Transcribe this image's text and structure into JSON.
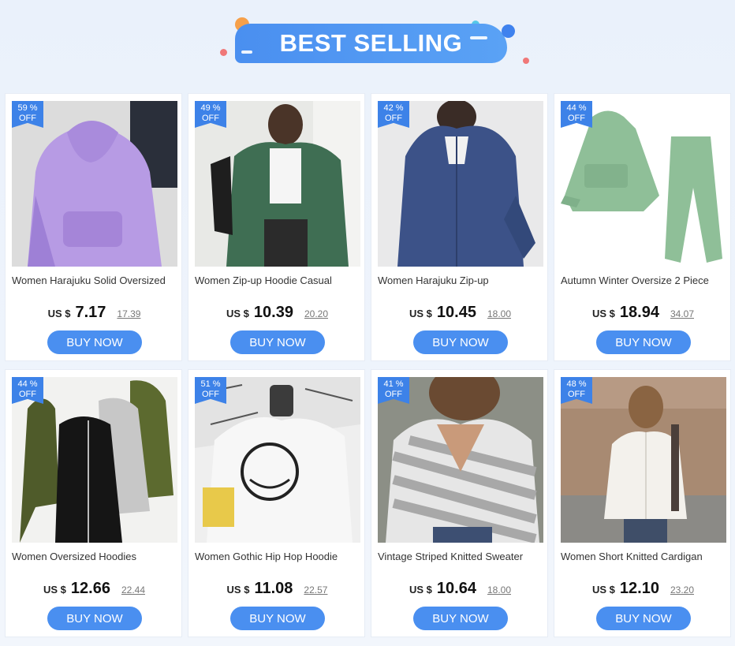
{
  "header": {
    "title": "BEST SELLING"
  },
  "colors": {
    "accent": "#4a8ff0",
    "badge": "#3d82e8"
  },
  "products": [
    {
      "name": "Women Harajuku Solid Oversized",
      "discount": "59 %",
      "off": "OFF",
      "currency": "US $",
      "price": "7.17",
      "old_price": "17.39",
      "buy": "BUY NOW",
      "image": "purple-hoodie"
    },
    {
      "name": "Women Zip-up Hoodie Casual",
      "discount": "49 %",
      "off": "OFF",
      "currency": "US $",
      "price": "10.39",
      "old_price": "20.20",
      "buy": "BUY NOW",
      "image": "green-zip-hoodie"
    },
    {
      "name": "Women Harajuku Zip-up",
      "discount": "42 %",
      "off": "OFF",
      "currency": "US $",
      "price": "10.45",
      "old_price": "18.00",
      "buy": "BUY NOW",
      "image": "navy-zip-hoodie"
    },
    {
      "name": "Autumn Winter Oversize 2 Piece",
      "discount": "44 %",
      "off": "OFF",
      "currency": "US $",
      "price": "18.94",
      "old_price": "34.07",
      "buy": "BUY NOW",
      "image": "mint-tracksuit"
    },
    {
      "name": "Women Oversized Hoodies",
      "discount": "44 %",
      "off": "OFF",
      "currency": "US $",
      "price": "12.66",
      "old_price": "22.44",
      "buy": "BUY NOW",
      "image": "long-hoodie-dresses"
    },
    {
      "name": "Women Gothic Hip Hop Hoodie",
      "discount": "51 %",
      "off": "OFF",
      "currency": "US $",
      "price": "11.08",
      "old_price": "22.57",
      "buy": "BUY NOW",
      "image": "graphic-white-hoodie"
    },
    {
      "name": "Vintage Striped Knitted Sweater",
      "discount": "41 %",
      "off": "OFF",
      "currency": "US $",
      "price": "10.64",
      "old_price": "18.00",
      "buy": "BUY NOW",
      "image": "striped-sweater"
    },
    {
      "name": "Women Short Knitted Cardigan",
      "discount": "48 %",
      "off": "OFF",
      "currency": "US $",
      "price": "12.10",
      "old_price": "23.20",
      "buy": "BUY NOW",
      "image": "white-cardigan"
    }
  ]
}
